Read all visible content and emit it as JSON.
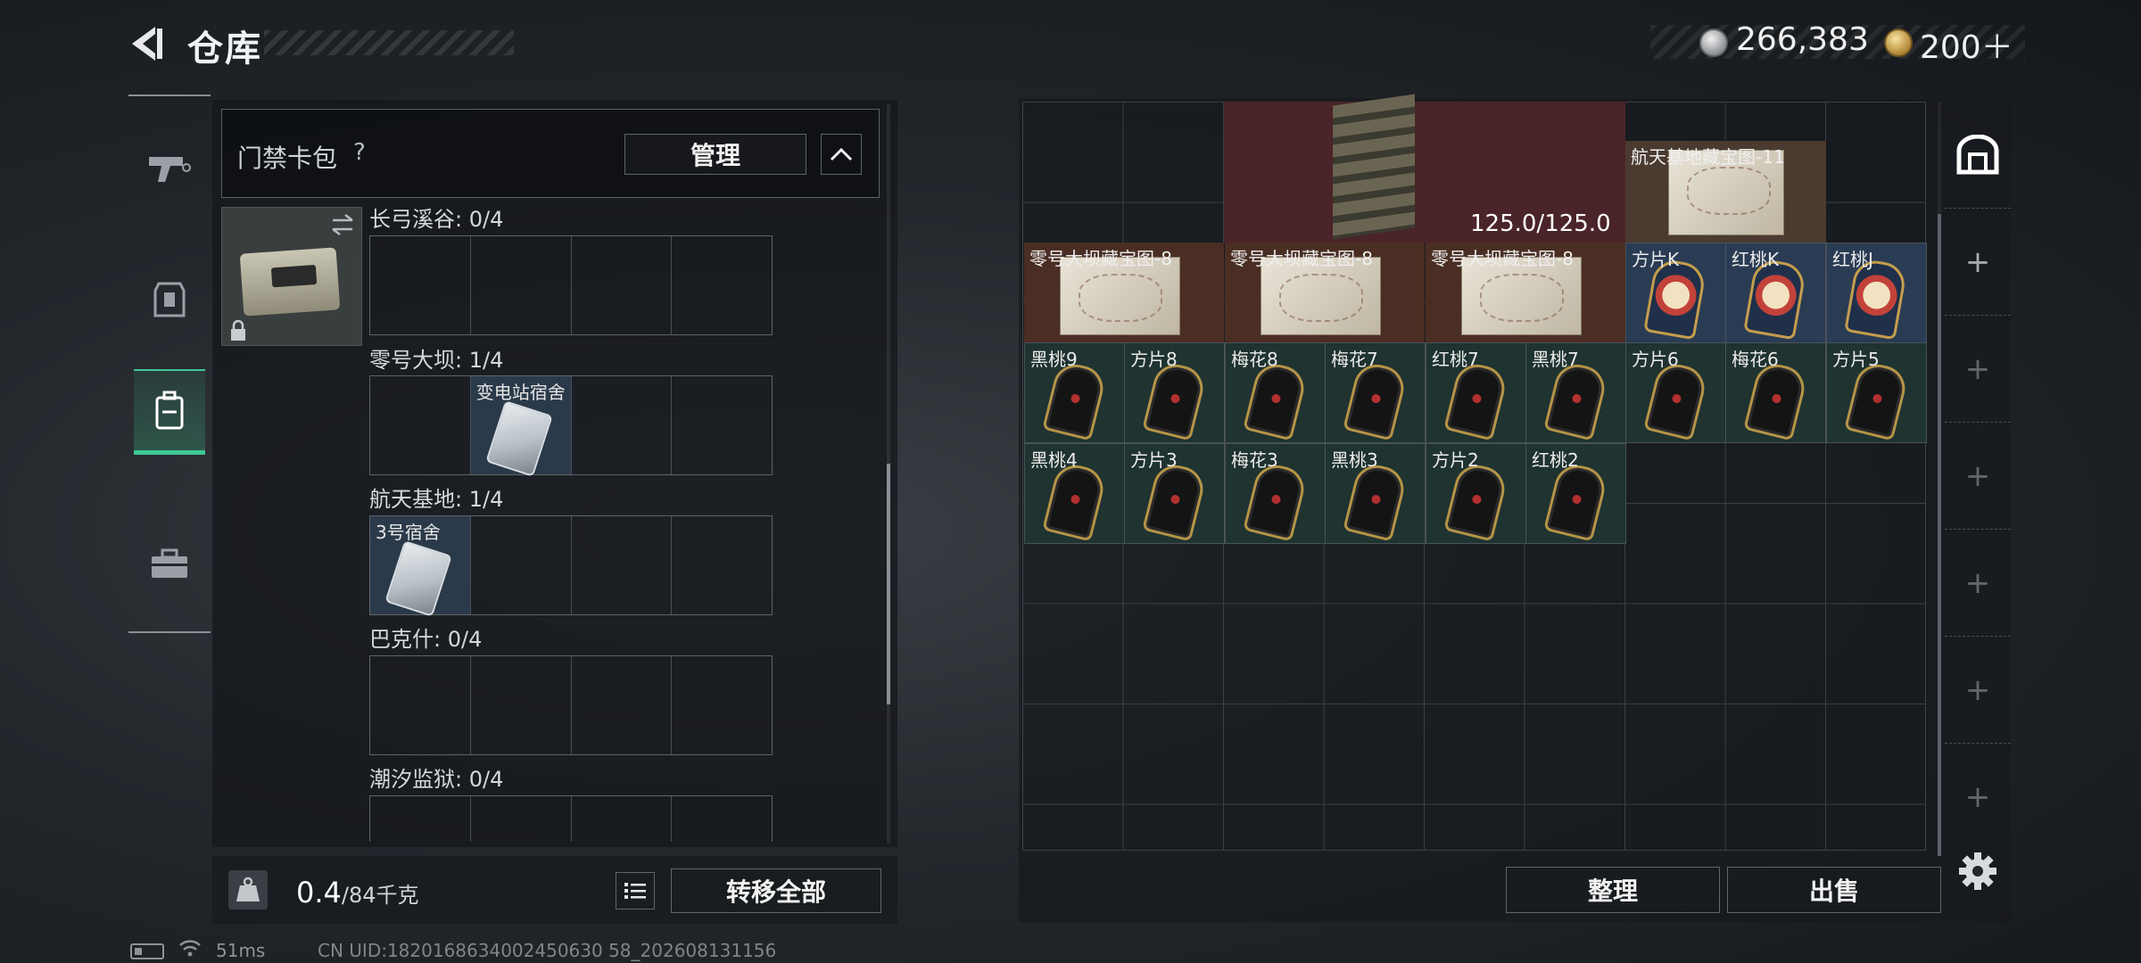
{
  "header": {
    "title": "仓库",
    "currency1": "266,383",
    "currency2": "200＋"
  },
  "nav": {
    "items": [
      "weapon-icon",
      "armor-icon",
      "backpack-icon",
      "toolbox-icon"
    ],
    "active": "backpack-icon",
    "accent_color": "#3ec893"
  },
  "keycard_panel": {
    "label": "门禁卡包",
    "help": "?",
    "manage_label": "管理",
    "regions": [
      {
        "label": "长弓溪谷: 0/4",
        "slots": [
          null,
          null,
          null,
          null
        ]
      },
      {
        "label": "零号大坝: 1/4",
        "slots": [
          null,
          "变电站宿舍",
          null,
          null
        ]
      },
      {
        "label": "航天基地: 1/4",
        "slots": [
          "3号宿舍",
          null,
          null,
          null
        ]
      },
      {
        "label": "巴克什: 0/4",
        "slots": [
          null,
          null,
          null,
          null
        ]
      },
      {
        "label": "潮汐监狱: 0/4",
        "slots": [
          null,
          null,
          null,
          null
        ]
      }
    ]
  },
  "bottom_bar": {
    "weight_current": "0.4",
    "weight_max": "/84千克",
    "transfer_label": "转移全部"
  },
  "status": {
    "ping": "51ms",
    "uid": "CN UID:1820168634002450630 58_202608131156"
  },
  "storage": {
    "stack_label": "125.0/125.0",
    "space_map": "航天基地藏宝图-11",
    "maps": [
      "零号大坝藏宝图-8",
      "零号大坝藏宝图-8",
      "零号大坝藏宝图-8"
    ],
    "face_cards": [
      "方片K",
      "红桃K",
      "红桃J"
    ],
    "row3": [
      "黑桃9",
      "方片8",
      "梅花8",
      "梅花7",
      "红桃7",
      "黑桃7",
      "方片6",
      "梅花6",
      "方片5"
    ],
    "row4": [
      "黑桃4",
      "方片3",
      "梅花3",
      "黑桃3",
      "方片2",
      "红桃2"
    ],
    "sort_label": "整理",
    "sell_label": "出售"
  },
  "side_tabs": [
    "storage-icon",
    "+",
    "+",
    "+",
    "+",
    "+",
    "+"
  ]
}
